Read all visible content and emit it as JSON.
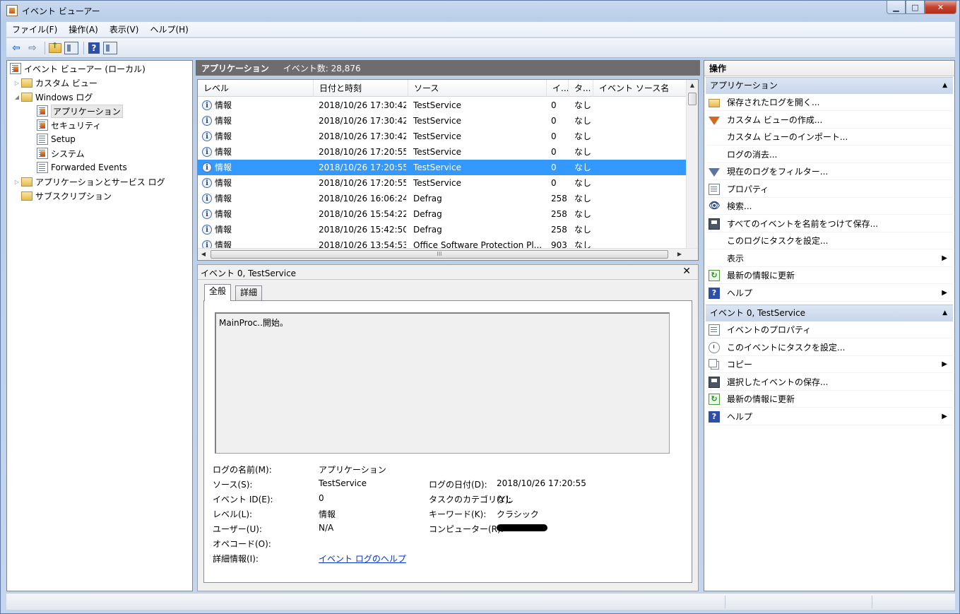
{
  "window": {
    "title": "イベント ビューアー",
    "controls": {
      "minimize": "▁",
      "maximize": "□",
      "close": "✕"
    }
  },
  "menu": [
    "ファイル(F)",
    "操作(A)",
    "表示(V)",
    "ヘルプ(H)"
  ],
  "toolbar": {
    "icons": [
      "back-arrow-icon",
      "forward-arrow-icon",
      "up-folder-icon",
      "show-hide-tree-icon",
      "help-icon",
      "show-hide-action-pane-icon"
    ],
    "back": "⇦",
    "forward": "⇨",
    "help": "?"
  },
  "tree": {
    "root": "イベント ビューアー (ローカル)",
    "custom_views": "カスタム ビュー",
    "windows_logs": "Windows ログ",
    "application": "アプリケーション",
    "security": "セキュリティ",
    "setup": "Setup",
    "system": "システム",
    "forwarded": "Forwarded Events",
    "app_service_logs": "アプリケーションとサービス ログ",
    "subscriptions": "サブスクリプション",
    "expander_collapsed": "▷",
    "expander_expanded": "◢"
  },
  "center": {
    "log_name": "アプリケーション",
    "event_count": "イベント数: 28,876",
    "columns": [
      "レベル",
      "日付と時刻",
      "ソース",
      "イ...",
      "タ...",
      "イベント ソース名"
    ],
    "rows": [
      {
        "level": "情報",
        "datetime": "2018/10/26 17:30:42",
        "source": "TestService",
        "id": "0",
        "task": "なし"
      },
      {
        "level": "情報",
        "datetime": "2018/10/26 17:30:42",
        "source": "TestService",
        "id": "0",
        "task": "なし"
      },
      {
        "level": "情報",
        "datetime": "2018/10/26 17:30:42",
        "source": "TestService",
        "id": "0",
        "task": "なし"
      },
      {
        "level": "情報",
        "datetime": "2018/10/26 17:20:55",
        "source": "TestService",
        "id": "0",
        "task": "なし"
      },
      {
        "level": "情報",
        "datetime": "2018/10/26 17:20:55",
        "source": "TestService",
        "id": "0",
        "task": "なし"
      },
      {
        "level": "情報",
        "datetime": "2018/10/26 17:20:55",
        "source": "TestService",
        "id": "0",
        "task": "なし"
      },
      {
        "level": "情報",
        "datetime": "2018/10/26 16:06:24",
        "source": "Defrag",
        "id": "258",
        "task": "なし"
      },
      {
        "level": "情報",
        "datetime": "2018/10/26 15:54:22",
        "source": "Defrag",
        "id": "258",
        "task": "なし"
      },
      {
        "level": "情報",
        "datetime": "2018/10/26 15:42:50",
        "source": "Defrag",
        "id": "258",
        "task": "なし"
      },
      {
        "level": "情報",
        "datetime": "2018/10/26 13:54:53",
        "source": "Office Software Protection Pl...",
        "id": "903",
        "task": "なし"
      }
    ],
    "selected_row": 4,
    "info_glyph": "i",
    "scroll": {
      "up": "▲",
      "down": "▼",
      "left": "◀",
      "right": "▶",
      "grip": "III"
    }
  },
  "detail": {
    "title": "イベント 0, TestService",
    "close": "✕",
    "tabs": [
      "全般",
      "詳細"
    ],
    "description": "MainProc..開始。",
    "fields": {
      "log_name_label": "ログの名前(M):",
      "log_name_value": "アプリケーション",
      "source_label": "ソース(S):",
      "source_value": "TestService",
      "logged_label": "ログの日付(D):",
      "logged_value": "2018/10/26 17:20:55",
      "event_id_label": "イベント ID(E):",
      "event_id_value": "0",
      "task_label": "タスクのカテゴリ(Y):",
      "task_value": "なし",
      "level_label": "レベル(L):",
      "level_value": "情報",
      "keywords_label": "キーワード(K):",
      "keywords_value": "クラシック",
      "user_label": "ユーザー(U):",
      "user_value": "N/A",
      "computer_label": "コンピューター(R):",
      "opcode_label": "オペコード(O):",
      "more_info_label": "詳細情報(I):",
      "more_info_link": "イベント ログのヘルプ"
    }
  },
  "actions": {
    "title": "操作",
    "section1": {
      "header": "アプリケーション",
      "caret": "▲",
      "items": [
        {
          "label": "保存されたログを開く...",
          "icon": "open-folder-icon"
        },
        {
          "label": "カスタム ビューの作成...",
          "icon": "create-filter-icon"
        },
        {
          "label": "カスタム ビューのインポート...",
          "icon": ""
        },
        {
          "label": "ログの消去...",
          "icon": ""
        },
        {
          "label": "現在のログをフィルター...",
          "icon": "filter-icon"
        },
        {
          "label": "プロパティ",
          "icon": "properties-icon"
        },
        {
          "label": "検索...",
          "icon": "binoculars-icon"
        },
        {
          "label": "すべてのイベントを名前をつけて保存...",
          "icon": "save-icon"
        },
        {
          "label": "このログにタスクを設定...",
          "icon": ""
        },
        {
          "label": "表示",
          "icon": "",
          "submenu": "▶"
        },
        {
          "label": "最新の情報に更新",
          "icon": "refresh-icon"
        },
        {
          "label": "ヘルプ",
          "icon": "help-icon",
          "submenu": "▶"
        }
      ]
    },
    "section2": {
      "header": "イベント 0, TestService",
      "caret": "▲",
      "items": [
        {
          "label": "イベントのプロパティ",
          "icon": "properties-icon"
        },
        {
          "label": "このイベントにタスクを設定...",
          "icon": "task-icon"
        },
        {
          "label": "コピー",
          "icon": "copy-icon",
          "submenu": "▶"
        },
        {
          "label": "選択したイベントの保存...",
          "icon": "save-icon"
        },
        {
          "label": "最新の情報に更新",
          "icon": "refresh-icon"
        },
        {
          "label": "ヘルプ",
          "icon": "help-icon",
          "submenu": "▶"
        }
      ]
    },
    "binoculars_glyph": "👁",
    "help_glyph": "?",
    "refresh_glyph": "↻"
  }
}
